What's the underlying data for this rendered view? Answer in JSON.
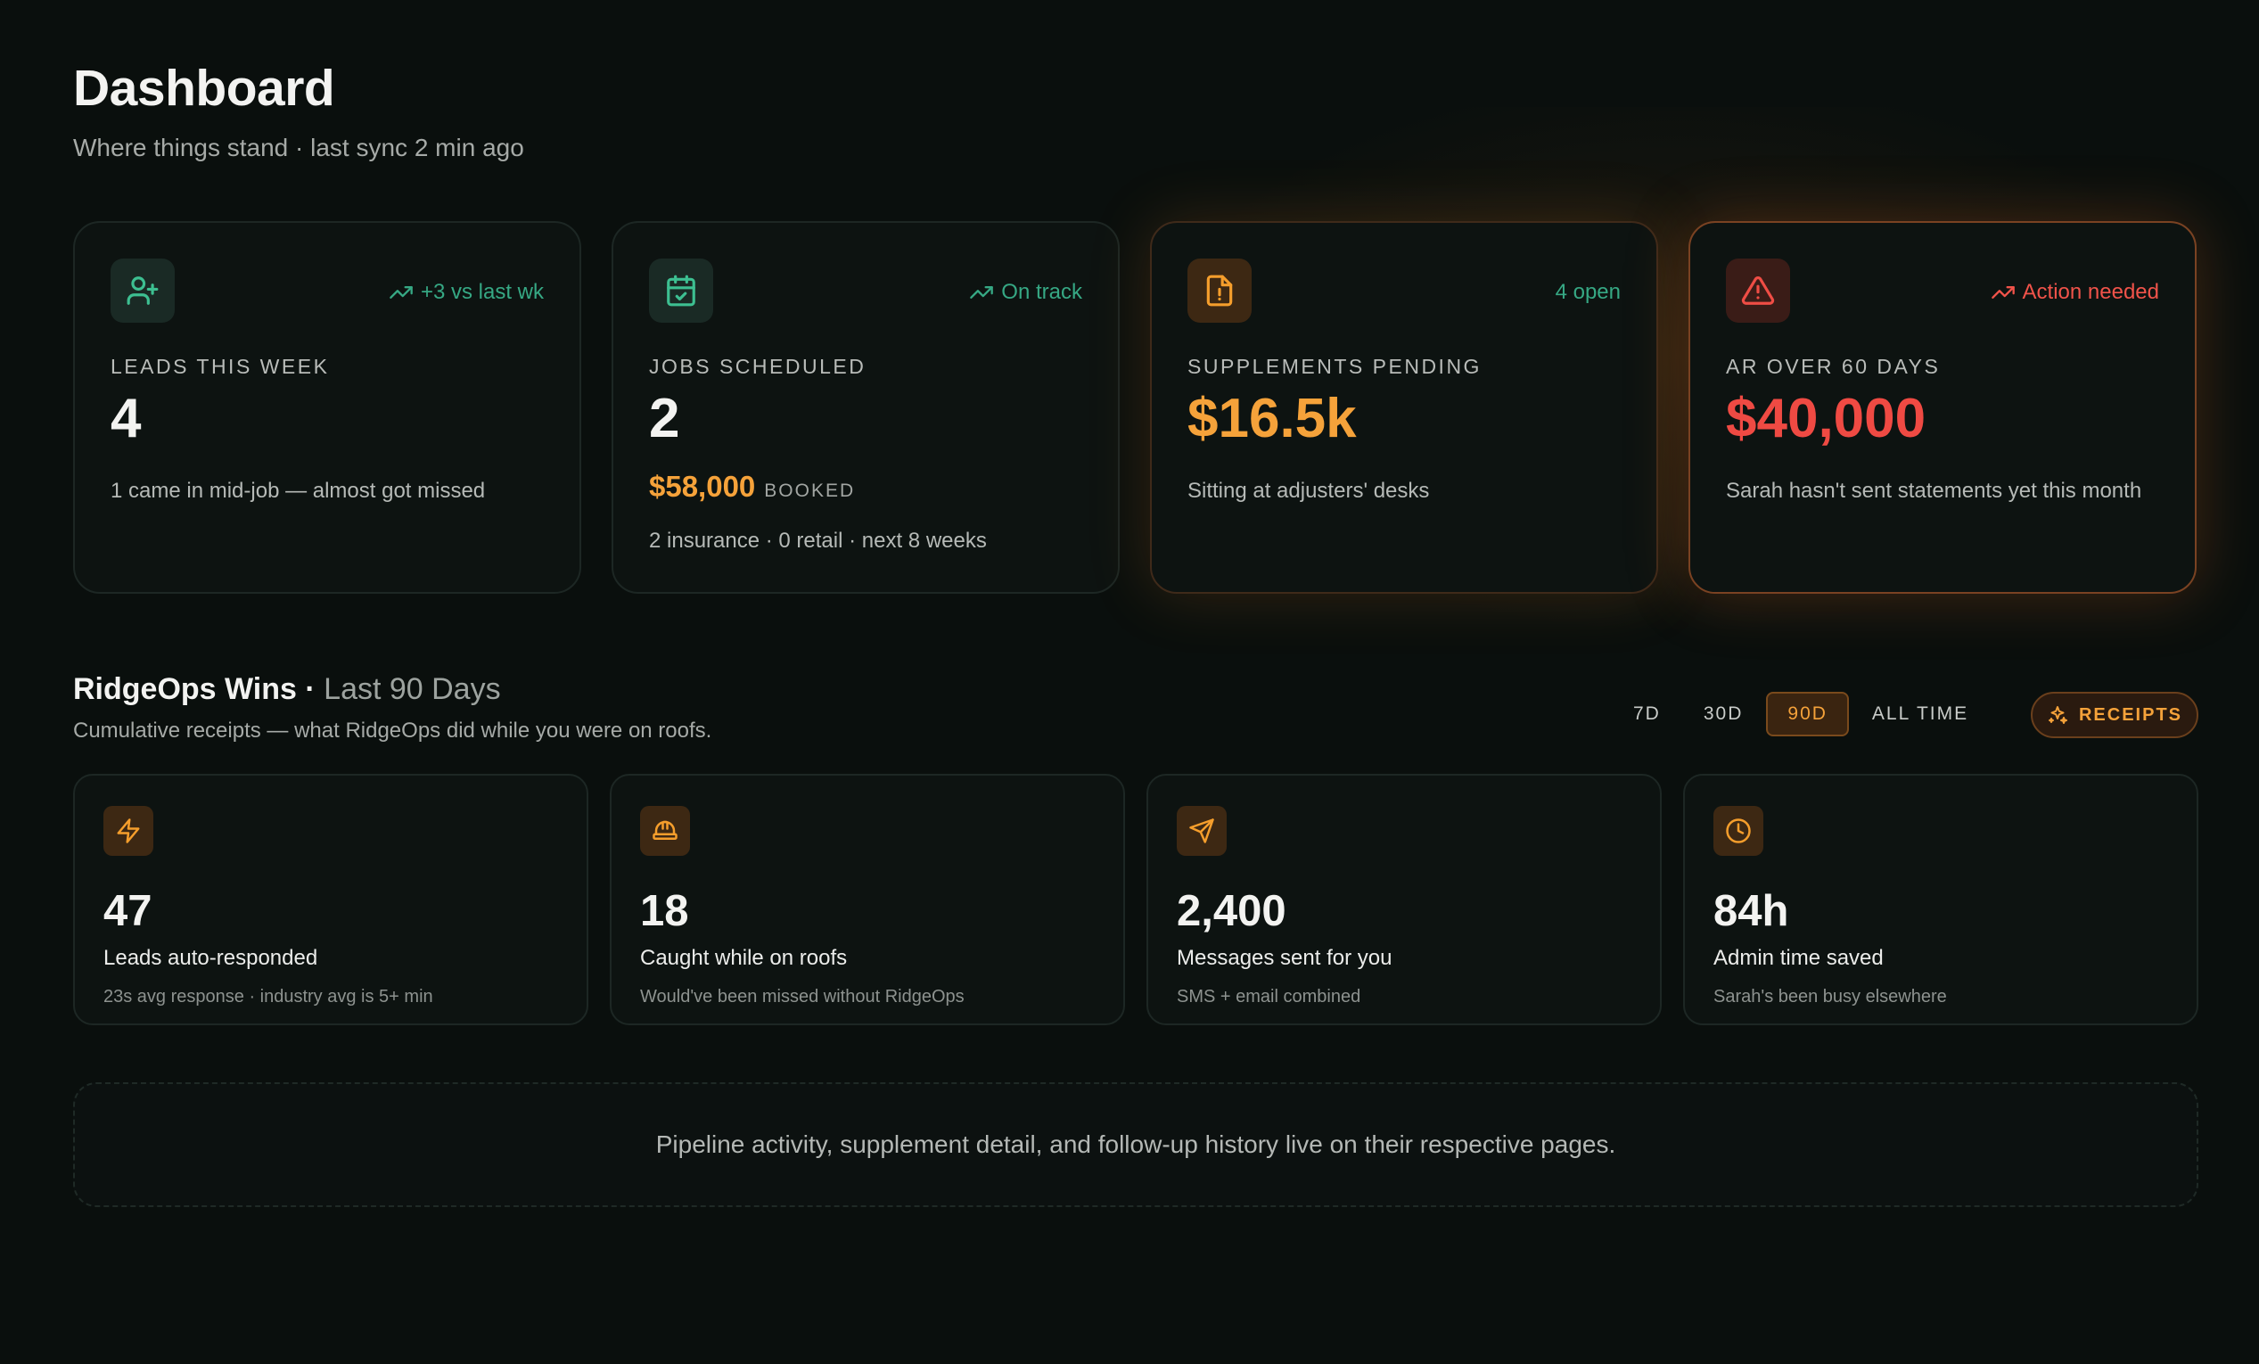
{
  "header": {
    "title": "Dashboard",
    "subtitle": "Where things stand · last sync 2 min ago"
  },
  "stats": [
    {
      "label": "LEADS THIS WEEK",
      "value": "4",
      "trend": "+3 vs last wk",
      "note": "1 came in mid-job — almost got missed",
      "icon": "user-plus-icon"
    },
    {
      "label": "JOBS SCHEDULED",
      "value": "2",
      "trend": "On track",
      "booked_amount": "$58,000",
      "booked_label": "BOOKED",
      "note": "2 insurance · 0 retail · next 8 weeks",
      "icon": "calendar-check-icon"
    },
    {
      "label": "SUPPLEMENTS PENDING",
      "value": "$16.5k",
      "trend": "4 open",
      "note": "Sitting at adjusters' desks",
      "icon": "file-alert-icon"
    },
    {
      "label": "AR OVER 60 DAYS",
      "value": "$40,000",
      "trend": "Action needed",
      "note": "Sarah hasn't sent statements yet this month",
      "icon": "warning-triangle-icon"
    }
  ],
  "wins": {
    "title": "RidgeOps Wins",
    "separator": " · ",
    "period": "Last 90 Days",
    "subtitle": "Cumulative receipts — what RidgeOps did while you were on roofs.",
    "ranges": [
      "7D",
      "30D",
      "90D",
      "ALL TIME"
    ],
    "active_range": "90D",
    "receipts_label": "RECEIPTS",
    "cards": [
      {
        "value": "47",
        "label": "Leads auto-responded",
        "note": "23s avg response · industry avg is 5+ min",
        "icon": "lightning-icon"
      },
      {
        "value": "18",
        "label": "Caught while on roofs",
        "note": "Would've been missed without RidgeOps",
        "icon": "hard-hat-icon"
      },
      {
        "value": "2,400",
        "label": "Messages sent for you",
        "note": "SMS + email combined",
        "icon": "send-icon"
      },
      {
        "value": "84h",
        "label": "Admin time saved",
        "note": "Sarah's been busy elsewhere",
        "icon": "clock-icon"
      }
    ]
  },
  "footer_note": "Pipeline activity, supplement detail, and follow-up history live on their respective pages.",
  "colors": {
    "background": "#0a0f0d",
    "accent_amber": "#f5a23a",
    "accent_green": "#36a884",
    "alert_red": "#ef4a43"
  }
}
